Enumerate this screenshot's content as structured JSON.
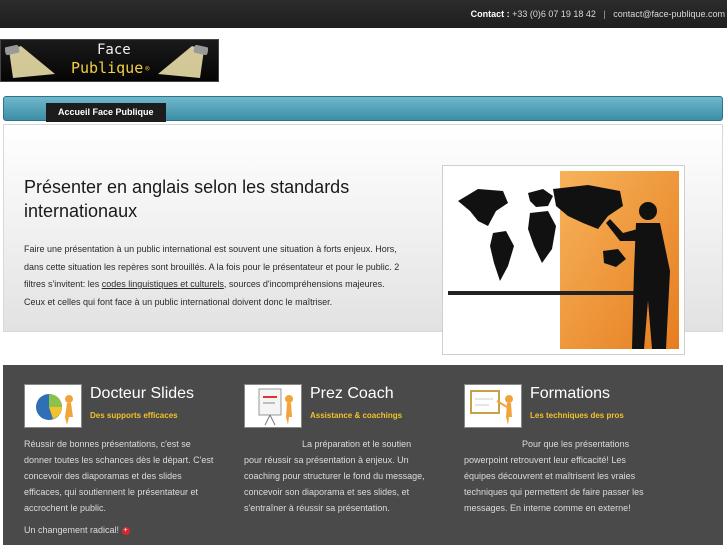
{
  "topbar": {
    "contact_label": "Contact :",
    "phone": "+33 (0)6 07 19 18 42",
    "separator": "|",
    "email": "contact@face-publique.com"
  },
  "logo": {
    "line1": "Face",
    "line2": "Publique",
    "mark": "®"
  },
  "nav": {
    "items": [
      {
        "label": "Accueil Face Publique"
      }
    ]
  },
  "hero": {
    "title": "Présenter en anglais selon les standards internationaux",
    "text_before_link": "Faire une présentation à un public international est souvent une situation à forts enjeux. Hors, dans cette situation les repères sont brouillés. A la fois pour le présentateur et pour le public. 2 filtres s'invitent: les ",
    "link_text": "codes linguistiques et culturels",
    "text_after_link": ", sources d'incompréhensions majeures. Ceux et celles qui font face à un public international doivent donc le maîtriser.",
    "image_icon": "presenter-world-map-icon"
  },
  "columns": [
    {
      "title": "Docteur Slides",
      "subtitle": "Des supports efficaces",
      "icon": "pie-chart-figure-icon",
      "body": "Réussir de bonnes présentations, c'est se donner toutes les schances dès le départ. C'est concevoir des diaporamas et des slides efficaces, qui soutiennent le présentateur et accrochent le public.",
      "extra": "Un changement radical!"
    },
    {
      "title": "Prez Coach",
      "subtitle": "Assistance & coachings",
      "icon": "flipchart-figure-icon",
      "body_lead": "La préparation et le soutien",
      "body": "pour réussir sa présentation à enjeux. Un coaching pour structurer le fond du message, concevoir son diaporama et ses slides, et s'entraîner à réussir sa présentation."
    },
    {
      "title": "Formations",
      "subtitle": "Les techniques des pros",
      "icon": "whiteboard-figure-icon",
      "body_lead": "Pour que les présentations",
      "body": "powerpoint retrouvent leur efficacité! Les équipes découvrent et maîtrisent les vraies techniques qui permettent de faire passer les messages. En interne comme en externe!"
    }
  ],
  "colors": {
    "accent_blue": "#4a9bb3",
    "subtitle_yellow": "#f2c22a",
    "band_gray": "#4a4a4a",
    "orange_board": "#f39a3b"
  }
}
